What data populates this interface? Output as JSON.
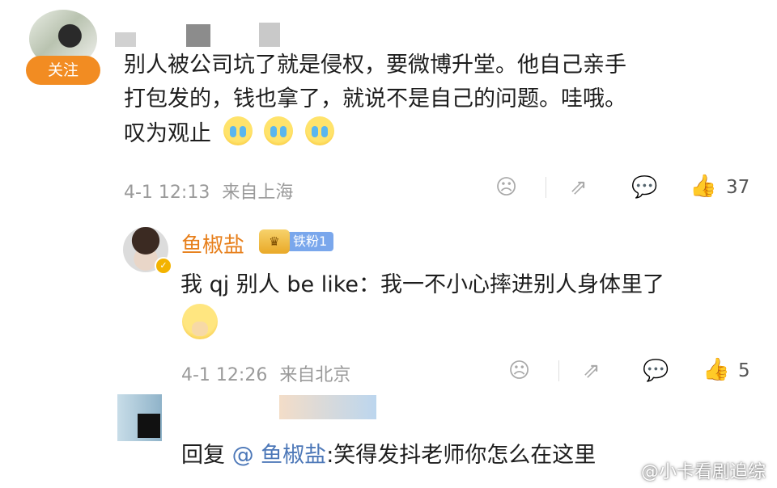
{
  "comment": {
    "follow_label": "关注",
    "text_lines": [
      "别人被公司坑了就是侵权，要微博升堂。他自己亲手",
      "打包发的，钱也拿了，就说不是自己的问题。哇哦。",
      "叹为观止"
    ],
    "time": "4-1 12:13",
    "location": "来自上海",
    "likes": "37"
  },
  "reply1": {
    "username": "鱼椒盐",
    "fan_badge": "铁粉1",
    "text": "我 qj 别人 be like：我一不小心摔进别人身体里了",
    "time": "4-1 12:26",
    "location": "来自北京",
    "likes": "5"
  },
  "reply2": {
    "prefix": "回复",
    "mention": "@ 鱼椒盐",
    "text": ":笑得发抖老师你怎么在这里"
  },
  "watermark": "@小卡看剧追综",
  "icons": {
    "dislike": "frown-face-icon",
    "share": "share-icon",
    "comment": "comment-bubble-icon",
    "like": "thumbs-up-icon"
  },
  "colors": {
    "accent_orange": "#f28c22",
    "username_orange": "#e77f1b",
    "mention_blue": "#4d78b8",
    "like_orange": "#f06b2a"
  }
}
